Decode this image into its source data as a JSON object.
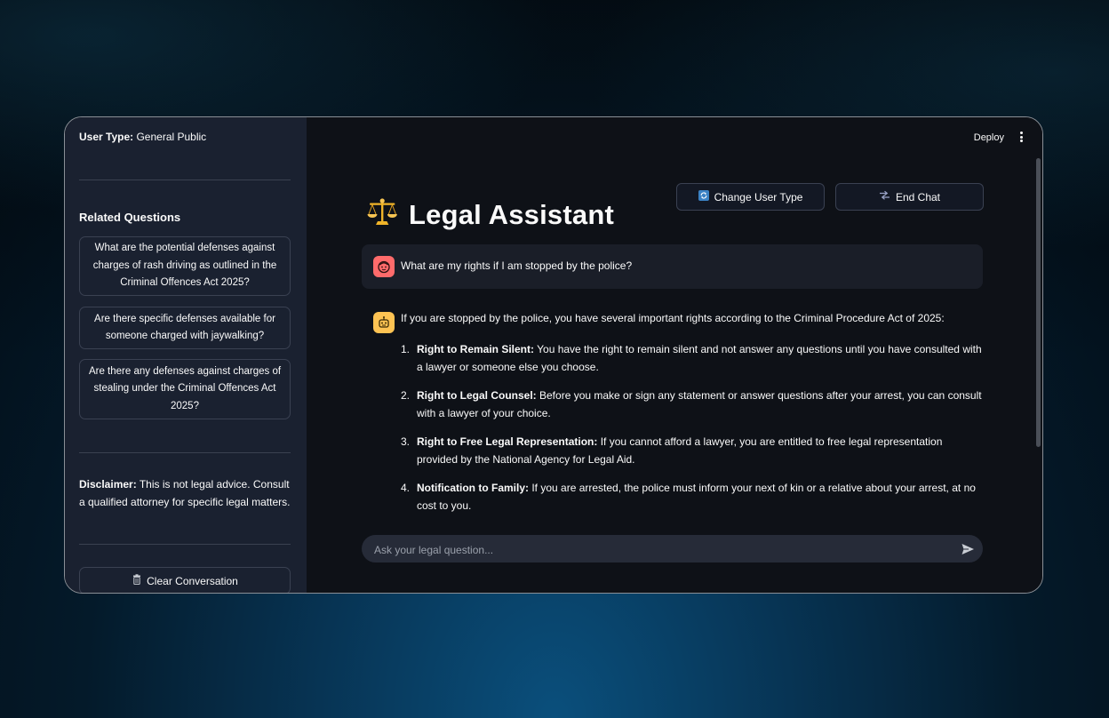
{
  "sidebar": {
    "user_type_label": "User Type:",
    "user_type_value": " General Public",
    "related_heading": "Related Questions",
    "related_questions": [
      "What are the potential defenses against charges of rash driving as outlined in the Criminal Offences Act 2025?",
      "Are there specific defenses available for someone charged with jaywalking?",
      "Are there any defenses against charges of stealing under the Criminal Offences Act 2025?"
    ],
    "disclaimer_label": "Disclaimer:",
    "disclaimer_text": " This is not legal advice. Consult a qualified attorney for specific legal matters.",
    "clear_button": "Clear Conversation",
    "clear_icon": "trash-icon"
  },
  "header": {
    "deploy_label": "Deploy",
    "menu_icon": "kebab-menu-icon"
  },
  "actions": {
    "change_user_type": "Change User Type",
    "change_user_type_icon": "refresh-icon",
    "end_chat": "End Chat",
    "end_chat_icon": "exit-icon"
  },
  "title": {
    "icon": "scales-icon",
    "text": "Legal Assistant"
  },
  "messages": {
    "user": {
      "avatar_icon": "user-face-icon",
      "text": "What are my rights if I am stopped by the police?"
    },
    "assistant": {
      "avatar_icon": "robot-icon",
      "intro": "If you are stopped by the police, you have several important rights according to the Criminal Procedure Act of 2025:",
      "rights": [
        {
          "num": "1.",
          "title": "Right to Remain Silent:",
          "text": " You have the right to remain silent and not answer any questions until you have consulted with a lawyer or someone else you choose."
        },
        {
          "num": "2.",
          "title": "Right to Legal Counsel:",
          "text": " Before you make or sign any statement or answer questions after your arrest, you can consult with a lawyer of your choice."
        },
        {
          "num": "3.",
          "title": "Right to Free Legal Representation:",
          "text": " If you cannot afford a lawyer, you are entitled to free legal representation provided by the National Agency for Legal Aid."
        },
        {
          "num": "4.",
          "title": "Notification to Family:",
          "text": " If you are arrested, the police must inform your next of kin or a relative about your arrest, at no cost to you."
        }
      ]
    }
  },
  "chat_input": {
    "placeholder": "Ask your legal question...",
    "value": "",
    "send_icon": "send-icon"
  },
  "colors": {
    "sidebar_bg": "#1a2130",
    "main_bg": "#0e1117",
    "user_avatar": "#ff6b6b",
    "bot_avatar": "#fdc353"
  }
}
